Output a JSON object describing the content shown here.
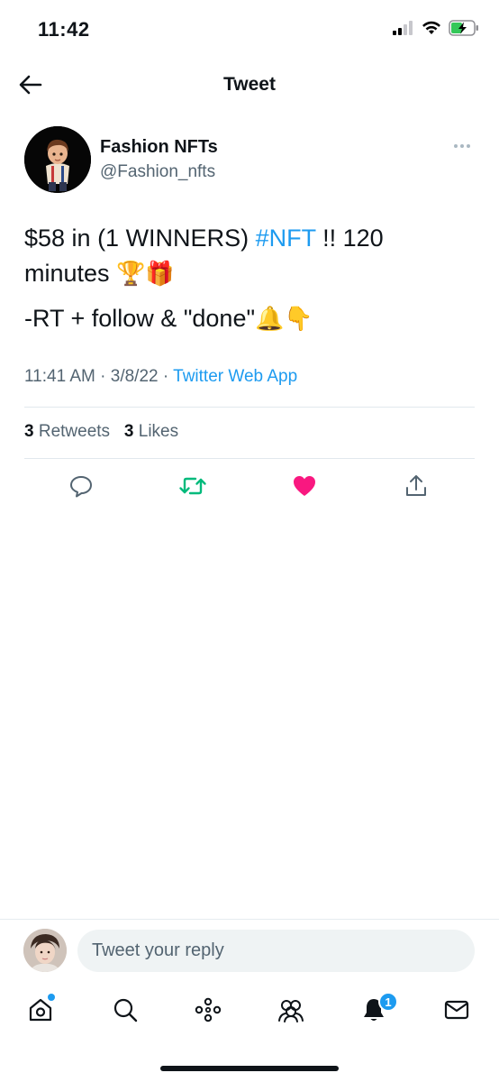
{
  "status_bar": {
    "time": "11:42",
    "icons": [
      "cellular-signal-icon",
      "wifi-icon",
      "battery-charging-icon"
    ]
  },
  "header": {
    "title": "Tweet",
    "back_icon": "back-arrow-icon"
  },
  "tweet": {
    "author": {
      "name": "Fashion NFTs",
      "handle": "@Fashion_nfts"
    },
    "text": {
      "line1_before": "$58 in  (1 WINNERS) ",
      "hashtag": "#NFT",
      "line1_after": " !! 120",
      "line2": "minutes ",
      "line2_emoji": "🏆🎁",
      "line3": "-RT + follow  & \"done\"",
      "line3_emoji": "🔔👇"
    },
    "meta": {
      "time": "11:41 AM",
      "separator": " · ",
      "date": "3/8/22",
      "source": "Twitter Web App"
    },
    "stats": {
      "retweets_count": "3",
      "retweets_label": " Retweets",
      "likes_count": "3",
      "likes_label": " Likes"
    },
    "actions": [
      "reply-icon",
      "retweet-icon",
      "like-icon",
      "share-icon"
    ],
    "liked": true,
    "retweeted": true
  },
  "reply": {
    "placeholder": "Tweet your reply"
  },
  "tab_bar": {
    "tabs": [
      "home-icon",
      "search-icon",
      "spaces-icon",
      "communities-icon",
      "notifications-icon",
      "messages-icon"
    ],
    "notifications_badge": "1"
  },
  "colors": {
    "accent": "#1d9bf0",
    "like": "#f91880",
    "retweet": "#00ba7c",
    "secondary_text": "#536471"
  }
}
